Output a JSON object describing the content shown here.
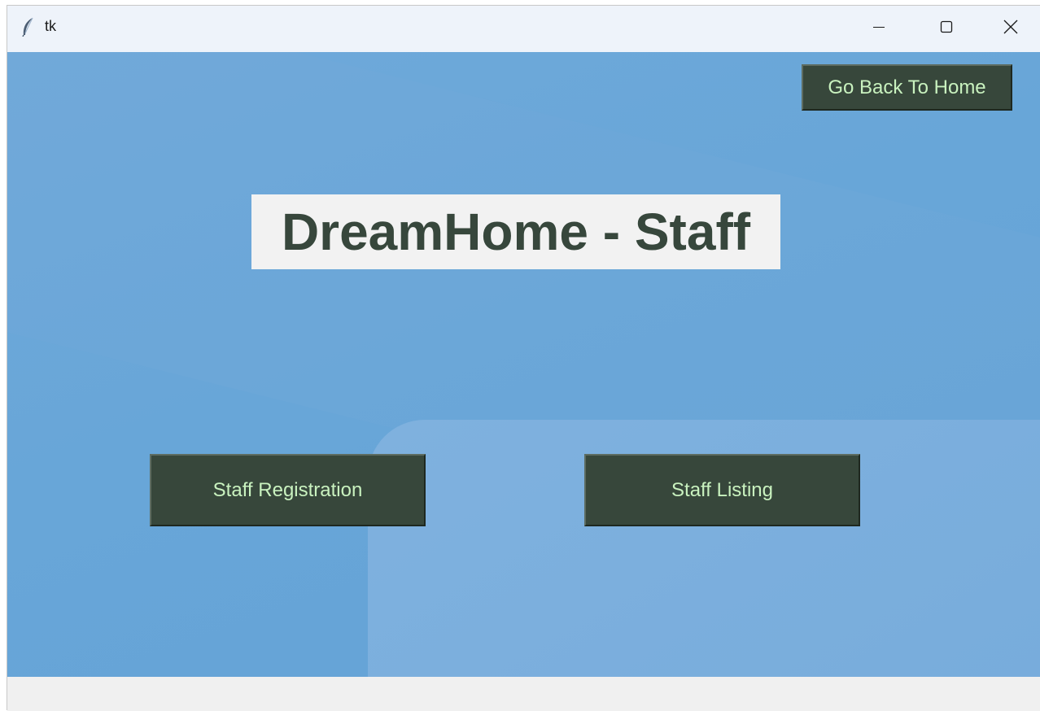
{
  "window": {
    "title": "tk",
    "app_icon": "feather-icon",
    "controls": {
      "minimize_icon": "minimize-icon",
      "maximize_icon": "maximize-icon",
      "close_icon": "close-icon"
    }
  },
  "main": {
    "heading": "DreamHome - Staff",
    "back_button_label": "Go Back To Home",
    "registration_button_label": "Staff Registration",
    "listing_button_label": "Staff Listing"
  },
  "colors": {
    "background": "#68a6d8",
    "button_bg": "#37473b",
    "button_text": "#c9f2bf",
    "heading_text": "#37473c",
    "heading_bg": "#f2f2f2"
  }
}
